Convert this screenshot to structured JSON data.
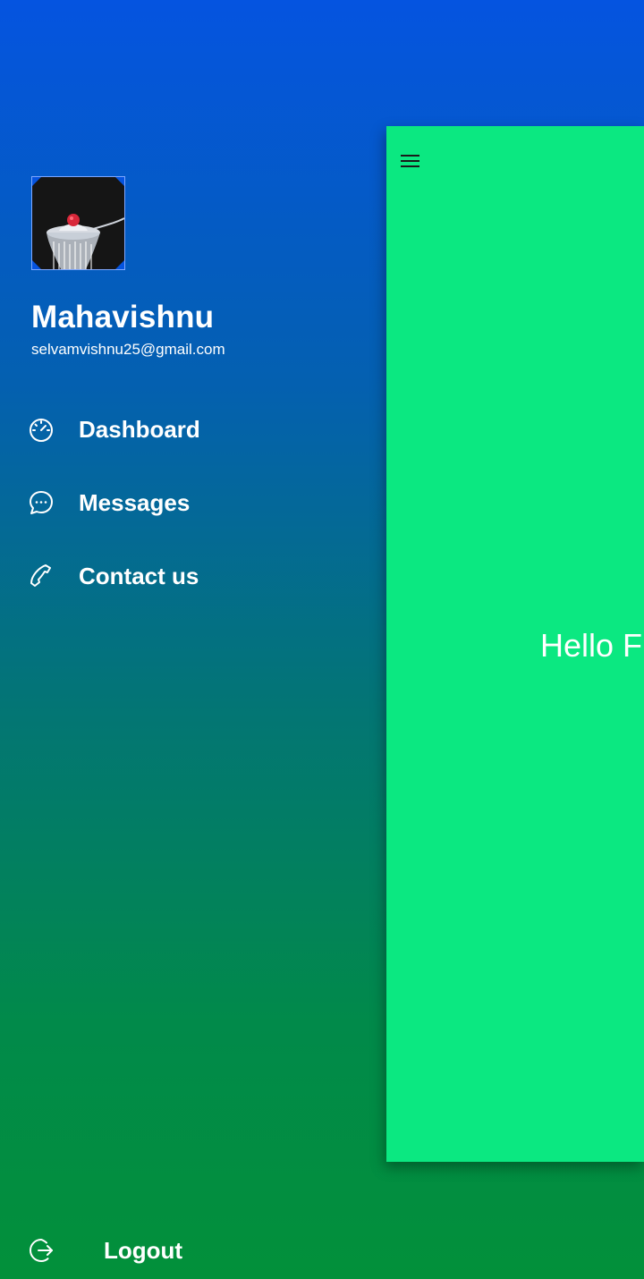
{
  "drawer": {
    "profile": {
      "avatar_icon": "cupcake-photo",
      "name": "Mahavishnu",
      "email": "selvamvishnu25@gmail.com"
    },
    "items": [
      {
        "label": "Dashboard",
        "icon": "speedometer-icon"
      },
      {
        "label": "Messages",
        "icon": "chat-bubble-icon"
      },
      {
        "label": "Contact us",
        "icon": "phone-icon"
      }
    ],
    "logout": {
      "label": "Logout",
      "icon": "logout-icon"
    }
  },
  "main": {
    "menu_icon": "hamburger-icon",
    "greeting": "Hello F",
    "background": "#0be881"
  },
  "colors": {
    "gradient_top": "#0554e0",
    "gradient_bottom": "#02903a",
    "text": "#ffffff"
  }
}
